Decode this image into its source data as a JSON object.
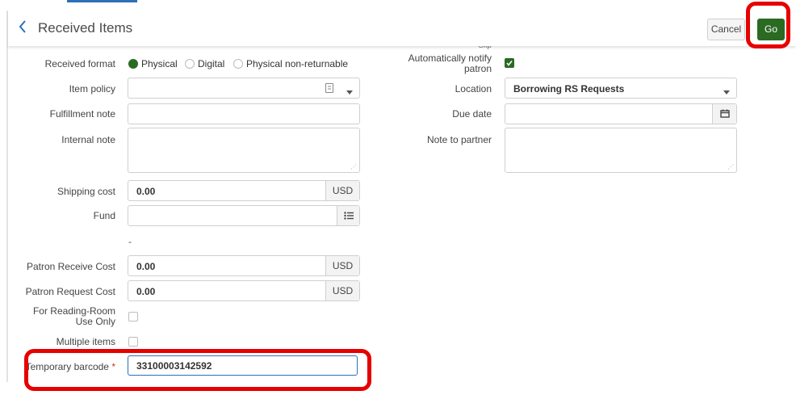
{
  "header": {
    "title": "Received Items",
    "cancel_label": "Cancel",
    "go_label": "Go"
  },
  "form": {
    "clipped_label": "Slip",
    "received_format": {
      "label": "Received format",
      "options": [
        "Physical",
        "Digital",
        "Physical non-returnable"
      ],
      "selected": "Physical"
    },
    "item_policy": {
      "label": "Item policy",
      "value": ""
    },
    "fulfillment_note": {
      "label": "Fulfillment note",
      "value": ""
    },
    "internal_note": {
      "label": "Internal note",
      "value": ""
    },
    "shipping_cost": {
      "label": "Shipping cost",
      "value": "0.00",
      "currency": "USD"
    },
    "fund": {
      "label": "Fund",
      "value": ""
    },
    "fund_dash": "-",
    "patron_receive_cost": {
      "label": "Patron Receive Cost",
      "value": "0.00",
      "currency": "USD"
    },
    "patron_request_cost": {
      "label": "Patron Request Cost",
      "value": "0.00",
      "currency": "USD"
    },
    "reading_room": {
      "label_line1": "For Reading-Room",
      "label_line2": "Use Only",
      "checked": false
    },
    "multiple_items": {
      "label": "Multiple items",
      "checked": false
    },
    "temporary_barcode": {
      "label": "Temporary barcode",
      "required_mark": "*",
      "value": "33100003142592"
    },
    "auto_notify": {
      "label_line1": "Automatically notify",
      "label_line2": "patron",
      "checked": true
    },
    "location": {
      "label": "Location",
      "value": "Borrowing RS Requests"
    },
    "due_date": {
      "label": "Due date",
      "value": ""
    },
    "note_to_partner": {
      "label": "Note to partner",
      "value": ""
    }
  },
  "colors": {
    "accent": "#2a6a22",
    "link": "#2d6fb8",
    "highlight": "#e60000"
  }
}
